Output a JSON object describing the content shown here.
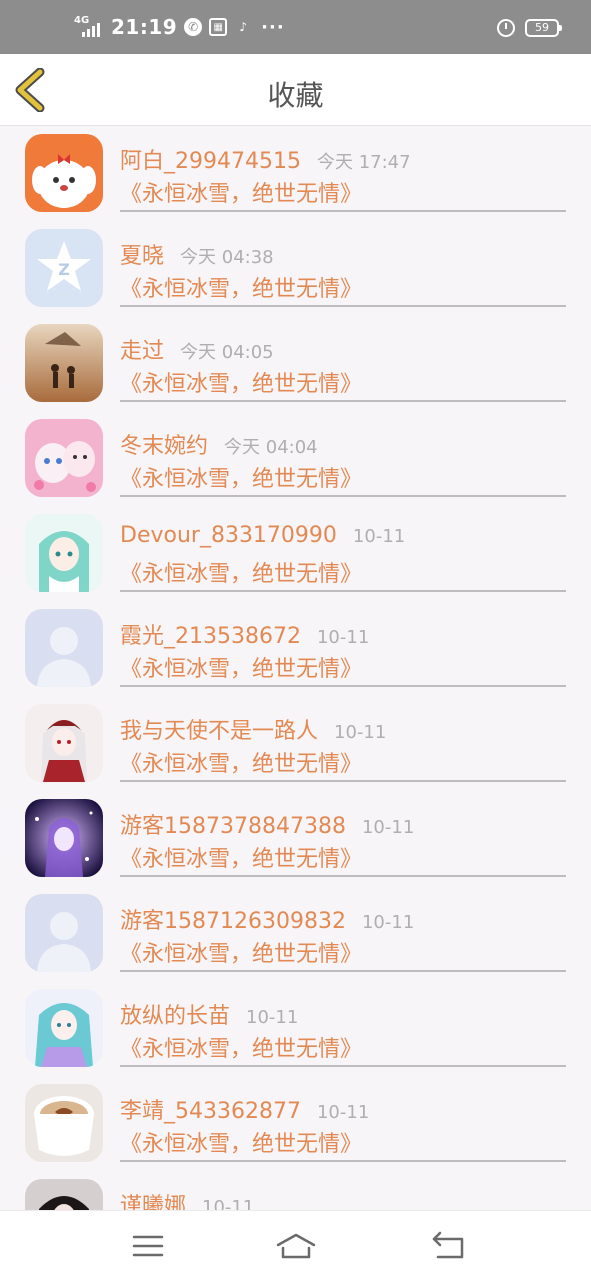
{
  "status_bar": {
    "network": "4G",
    "time": "21:19",
    "notif_icons": [
      "messenger-icon",
      "app-badge-icon",
      "tiktok-icon"
    ],
    "more": "···",
    "battery": "59"
  },
  "header": {
    "title": "收藏"
  },
  "favorites": [
    {
      "name": "阿白_299474515",
      "time": "今天 17:47",
      "message": "《永恒冰雪，绝世无情》",
      "avatar": "cartoon-dog-avatar"
    },
    {
      "name": "夏晓",
      "time": "今天 04:38",
      "message": "《永恒冰雪，绝世无情》",
      "avatar": "qq-logo-avatar"
    },
    {
      "name": "走过",
      "time": "今天 04:05",
      "message": "《永恒冰雪，绝世无情》",
      "avatar": "silhouette-couple-avatar"
    },
    {
      "name": "冬末婉约",
      "time": "今天 04:04",
      "message": "《永恒冰雪，绝世无情》",
      "avatar": "kittens-avatar"
    },
    {
      "name": "Devour_833170990",
      "time": "10-11",
      "message": "《永恒冰雪，绝世无情》",
      "avatar": "anime-girl-avatar"
    },
    {
      "name": "霞光_213538672",
      "time": "10-11",
      "message": "《永恒冰雪，绝世无情》",
      "avatar": "default-avatar"
    },
    {
      "name": "我与天使不是一路人",
      "time": "10-11",
      "message": "《永恒冰雪，绝世无情》",
      "avatar": "anime-red-dress-avatar"
    },
    {
      "name": "游客1587378847388",
      "time": "10-11",
      "message": "《永恒冰雪，绝世无情》",
      "avatar": "anime-purple-avatar"
    },
    {
      "name": "游客1587126309832",
      "time": "10-11",
      "message": "《永恒冰雪，绝世无情》",
      "avatar": "default-avatar"
    },
    {
      "name": "放纵的长苗",
      "time": "10-11",
      "message": "《永恒冰雪，绝世无情》",
      "avatar": "anime-teal-hair-avatar"
    },
    {
      "name": "李靖_543362877",
      "time": "10-11",
      "message": "《永恒冰雪，绝世无情》",
      "avatar": "coffee-cup-avatar"
    },
    {
      "name": "谨曦娜",
      "time": "10-11",
      "message": "",
      "avatar": "dark-hair-avatar"
    }
  ],
  "colors": {
    "accent": "#e38a54",
    "secondary_text": "#b0aeb0",
    "back_arrow": "#e2c23a"
  },
  "nav": [
    "menu-icon",
    "home-icon",
    "back-icon"
  ]
}
